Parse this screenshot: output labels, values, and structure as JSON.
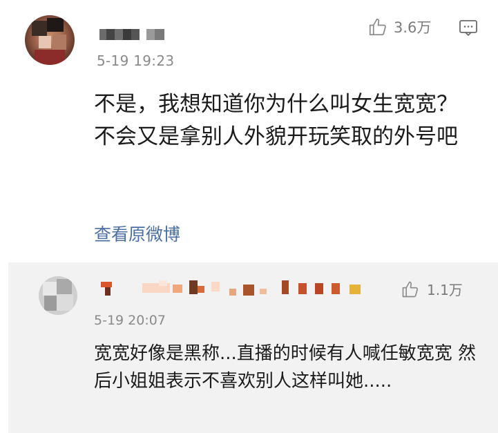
{
  "main_comment": {
    "timestamp": "5-19 19:23",
    "like_count": "3.6万",
    "like_icon": "thumb-up-icon",
    "comment_icon": "comment-icon",
    "text": "不是，我想知道你为什么叫女生宽宽？不会又是拿别人外貌开玩笑取的外号吧",
    "view_original_label": "查看原微博"
  },
  "reply": {
    "timestamp": "5-19 20:07",
    "like_count": "1.1万",
    "like_icon": "thumb-up-icon",
    "text": "宽宽好像是黑称...直播的时候有人喊任敏宽宽 然后小姐姐表示不喜欢别人这样叫她....."
  },
  "colors": {
    "link": "#4b6fa3",
    "meta": "#8a8a8a",
    "reply_bg": "#f2f2f2",
    "text": "#1b1b1b"
  }
}
